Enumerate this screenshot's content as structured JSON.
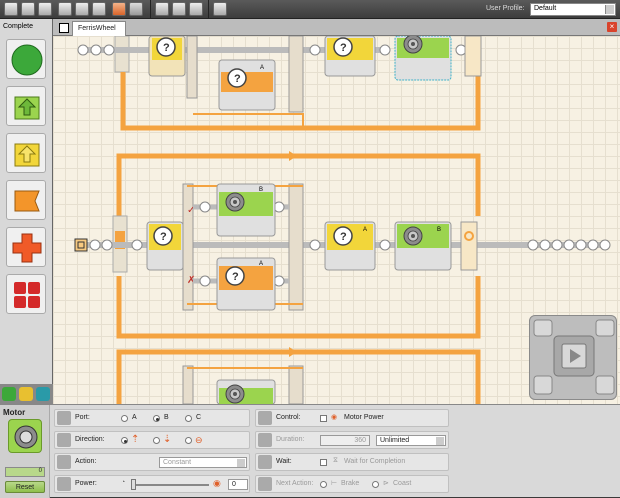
{
  "toolbar": {
    "user_profile_label": "User Profile:",
    "user_profile_value": "Default"
  },
  "palette": {
    "title": "Complete"
  },
  "tabs": {
    "file_name": "FerrisWheel"
  },
  "program_blocks": {
    "motor_ports": [
      "B",
      "A",
      "A",
      "B",
      "B",
      "A"
    ],
    "motor_port_labels": [
      "A",
      "B",
      "A",
      "A",
      "B"
    ]
  },
  "props": {
    "block_title": "Motor",
    "reset_label": "Reset",
    "port_label": "Port:",
    "port_options": [
      "A",
      "B",
      "C"
    ],
    "port_selected": "B",
    "direction_label": "Direction:",
    "action_label": "Action:",
    "action_value": "Constant",
    "power_label": "Power:",
    "power_value": "0",
    "control_label": "Control:",
    "motor_power_label": "Motor Power",
    "duration_label": "Duration:",
    "duration_value": "360",
    "duration_unit": "Unlimited",
    "wait_label": "Wait:",
    "wait_for_completion_label": "Wait for Completion",
    "next_action_label": "Next Action:",
    "brake_label": "Brake",
    "coast_label": "Coast"
  }
}
